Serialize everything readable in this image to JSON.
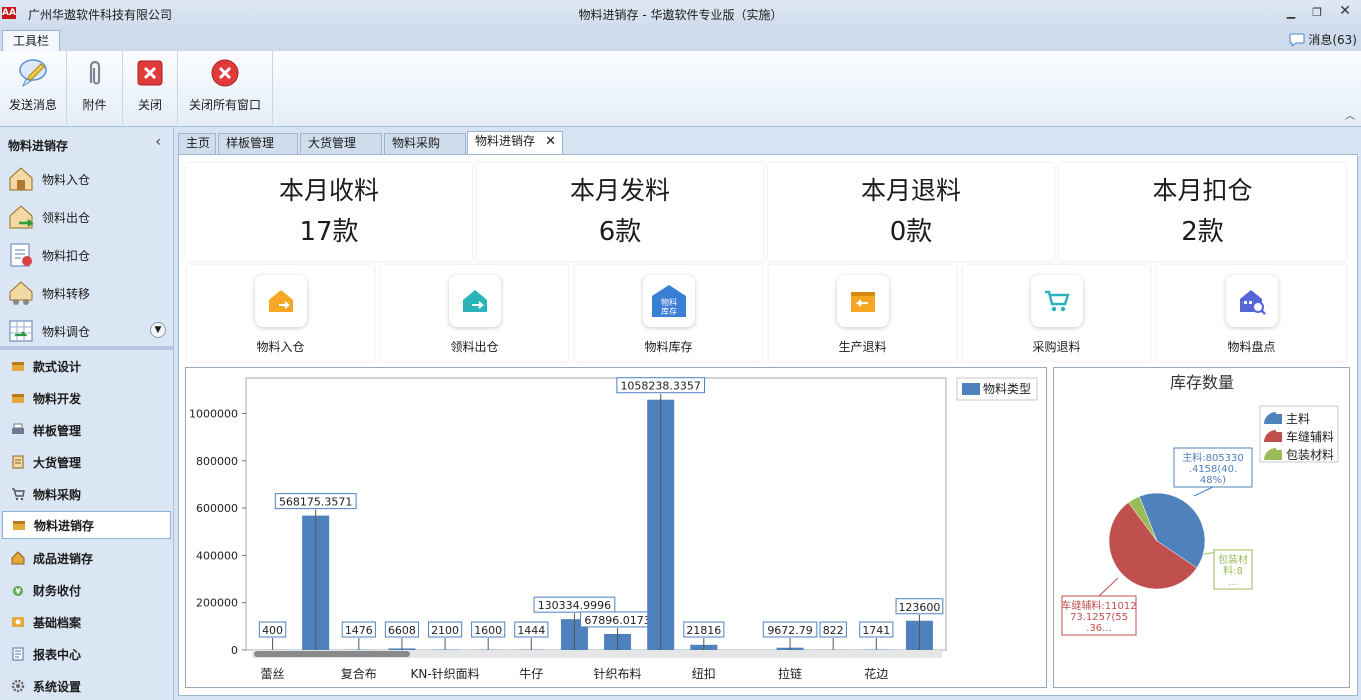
{
  "titlebar": {
    "logo": "AA",
    "company": "广州华遨软件科技有限公司",
    "title": "物料进销存 - 华遨软件专业版（实施）"
  },
  "tabstrip": {
    "toolbar_tab": "工具栏",
    "messages": "消息(63)"
  },
  "ribbon": {
    "buttons": [
      "发送消息",
      "附件",
      "关闭",
      "关闭所有窗口"
    ]
  },
  "sidebar": {
    "header": "物料进销存",
    "sub_items": [
      "物料入仓",
      "领料出仓",
      "物料扣仓",
      "物料转移",
      "物料调仓"
    ],
    "nav_items": [
      "款式设计",
      "物料开发",
      "样板管理",
      "大货管理",
      "物料采购",
      "物料进销存",
      "成品进销存",
      "财务收付",
      "基础档案",
      "报表中心",
      "系统设置"
    ],
    "active_nav": "物料进销存"
  },
  "doc_tabs": [
    "主页",
    "样板管理",
    "大货管理",
    "物料采购",
    "物料进销存"
  ],
  "stats": [
    {
      "title": "本月收料",
      "value": "17款"
    },
    {
      "title": "本月发料",
      "value": "6款"
    },
    {
      "title": "本月退料",
      "value": "0款"
    },
    {
      "title": "本月扣仓",
      "value": "2款"
    }
  ],
  "tiles": [
    {
      "label": "物料入仓",
      "icon": "warehouse-in-icon",
      "color": "#f5a623"
    },
    {
      "label": "领料出仓",
      "icon": "warehouse-out-icon",
      "color": "#2ab3b8"
    },
    {
      "label": "物料库存",
      "icon": "inventory-icon",
      "color": "#3b7ed6",
      "icon_text": "物料库存"
    },
    {
      "label": "生产退料",
      "icon": "production-return-icon",
      "color": "#f5a623"
    },
    {
      "label": "采购退料",
      "icon": "purchase-return-icon",
      "color": "#2ab3b8"
    },
    {
      "label": "物料盘点",
      "icon": "stocktake-icon",
      "color": "#5566d8"
    }
  ],
  "chart_data": [
    {
      "type": "bar",
      "legend": [
        "物料类型"
      ],
      "legend_position": "top-right",
      "series": [
        {
          "name": "物料类型",
          "color": "#4f81bd",
          "values": [
            400,
            568175.3571,
            1476,
            6608,
            2100,
            1600,
            1444,
            130334.9996,
            67896.0173,
            1058238.3357,
            21816,
            0,
            9672.79,
            822,
            1741,
            123600
          ]
        }
      ],
      "data_labels": [
        "400",
        "568175.3571",
        "1476",
        "6608",
        "2100",
        "1600",
        "1444",
        "130334.9996",
        "67896.0173",
        "1058238.3357",
        "21816",
        "",
        "9672.79",
        "822",
        "1741",
        "123600"
      ],
      "x_tick_labels": [
        "蕾丝",
        "",
        "复合布",
        "",
        "KN-针织面料",
        "",
        "牛仔",
        "",
        "针织布料",
        "",
        "纽扣",
        "",
        "拉链",
        "",
        "花边",
        ""
      ],
      "y_ticks": [
        "0",
        "200000",
        "400000",
        "600000",
        "800000",
        "1000000"
      ],
      "ylim": [
        0,
        1150000
      ],
      "grid": false
    },
    {
      "type": "pie",
      "title": "库存数量",
      "legend_position": "top-right",
      "slices": [
        {
          "name": "主料",
          "value": 805330.4158,
          "percent": 40.48,
          "color": "#4f81bd",
          "label": "主料:805330.4158(40.48%)"
        },
        {
          "name": "车缝辅料",
          "value": 1101273.1257,
          "percent": 55.36,
          "color": "#c0504d",
          "label": "车缝辅料:1101273.1257(55.36..."
        },
        {
          "name": "包装材料",
          "value": 82760,
          "percent": 4.16,
          "color": "#9bbb59",
          "label": "包装材料:8..."
        }
      ]
    }
  ]
}
